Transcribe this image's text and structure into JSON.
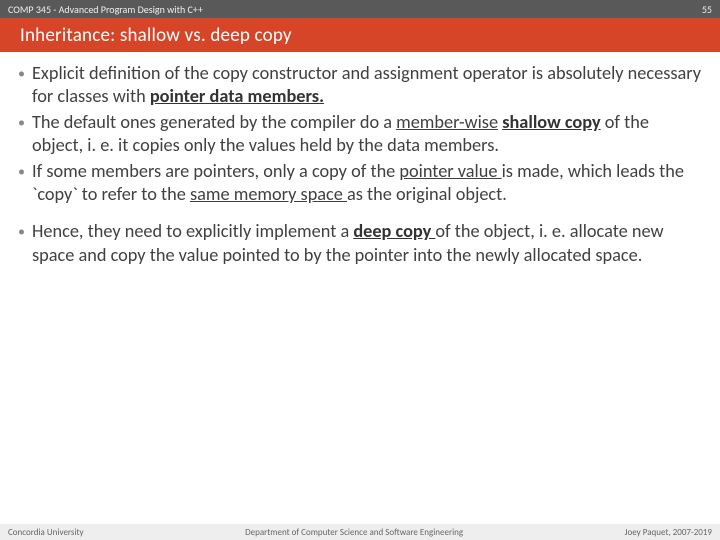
{
  "header": {
    "course": "COMP 345 - Advanced Program Design with C++",
    "slide_number": "55"
  },
  "title": "Inheritance: shallow vs. deep copy",
  "bullets": [
    {
      "pre": "Explicit definition of the copy constructor and assignment operator is absolutely necessary for classes with ",
      "emph": "pointer data members.",
      "post": ""
    },
    {
      "pre": "The default ones generated by the compiler do a ",
      "emph1_text": "member-wise",
      "mid1": " ",
      "emph2_text": "shallow copy",
      "post": " of the object, i. e. it copies only the values held by the data members."
    },
    {
      "pre": "If some members are pointers, only a copy of the ",
      "emph1_text": "pointer value ",
      "mid1": "is made, which leads the `copy` to refer to the ",
      "emph2_text": "same memory space ",
      "post": "as the original object."
    },
    {
      "pre": "Hence, they need to explicitly implement a ",
      "emph": "deep copy ",
      "post": "of the object, i. e. allocate new space and copy the value pointed to by the pointer into the newly allocated space."
    }
  ],
  "footer": {
    "left": "Concordia University",
    "center": "Department of Computer Science and Software Engineering",
    "right": "Joey Paquet, 2007-2019"
  }
}
